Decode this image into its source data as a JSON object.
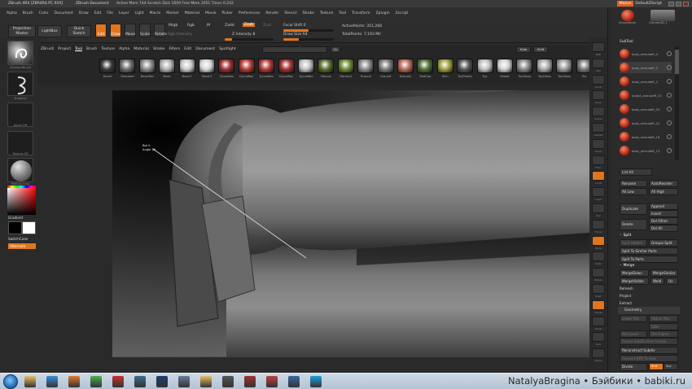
{
  "app": {
    "title": "ZBrush 4R4 [ZBR4R4.PC.XXX]",
    "document": "ZBrush Document",
    "stats": "Active Mem 744  Scratch Disk 1609  Free Mem 2051  Timer 0.242",
    "menus_button": "Menus",
    "script_label": "DefaultZScript"
  },
  "menubar": [
    "Alpha",
    "Brush",
    "Color",
    "Document",
    "Draw",
    "Edit",
    "File",
    "Layer",
    "Light",
    "Macro",
    "Marker",
    "Material",
    "Movie",
    "Picker",
    "Preferences",
    "Render",
    "Stencil",
    "Stroke",
    "Texture",
    "Tool",
    "Transform",
    "Zplugin",
    "Zscript"
  ],
  "topshelf": {
    "projection_master": "Projection Master",
    "lightbox": "LightBox",
    "quick_sketch": "Quick Sketch",
    "edit": "Edit",
    "draw": "Draw",
    "move": "Move",
    "scale": "Scale",
    "rotate": "Rotate",
    "mrgb": "Mrgb",
    "rgb": "Rgb",
    "m": "M",
    "zadd": "Zadd",
    "zsub": "Zsub",
    "zcut": "Zcut",
    "rgb_intensity": "Rgb Intensity",
    "z_intensity": "Z Intensity 8",
    "focal_shift": "Focal Shift 0",
    "draw_size": "Draw Size 64",
    "active_points": "ActivePoints: 351,268",
    "total_points": "TotalPoints: 7.193 Mil",
    "focal_shift_level": 0.5,
    "draw_size_level": 0.3,
    "z_intensity_level": 0.15
  },
  "toolpalette": {
    "tabs": [
      "ZBrush",
      "Project",
      "Tool",
      "Brush",
      "Texture",
      "Alpha",
      "Material",
      "Stroke",
      "Filters",
      "Edit",
      "Document",
      "Spotlight"
    ],
    "active_tab": "Tool",
    "go_button": "Go",
    "hide_button": "Hide",
    "shift_button": "Shift",
    "items": [
      {
        "label": "DamS",
        "color": "#3a3a3a"
      },
      {
        "label": "Standard",
        "color": "#6a6a6a"
      },
      {
        "label": "BasicMat",
        "color": "#8a8a8a"
      },
      {
        "label": "Basic",
        "color": "#b0b0b0"
      },
      {
        "label": "Basic2",
        "color": "#c8c8c8"
      },
      {
        "label": "Basic3",
        "color": "#d4d4d4"
      },
      {
        "label": "DynaWax",
        "color": "#9a3030"
      },
      {
        "label": "DynaWax",
        "color": "#b83a3a"
      },
      {
        "label": "DynaWax",
        "color": "#b03a3a"
      },
      {
        "label": "DynaWax",
        "color": "#a33030"
      },
      {
        "label": "DynaWax",
        "color": "#c0c0c0"
      },
      {
        "label": "Fibrous",
        "color": "#596c2f"
      },
      {
        "label": "Fibrous1",
        "color": "#6a8a33"
      },
      {
        "label": "Ground",
        "color": "#8a8a8a"
      },
      {
        "label": "Ground",
        "color": "#7a7a7a"
      },
      {
        "label": "Kutsuko",
        "color": "#b86a5a"
      },
      {
        "label": "MatCap",
        "color": "#50703a"
      },
      {
        "label": "Skin",
        "color": "#a0a040"
      },
      {
        "label": "ToyPlastic",
        "color": "#555"
      },
      {
        "label": "Toy",
        "color": "#c0c0c0"
      },
      {
        "label": "Shade",
        "color": "#d0d0d0"
      },
      {
        "label": "ToyGlass",
        "color": "#888"
      },
      {
        "label": "ToyGlass",
        "color": "#aaa"
      },
      {
        "label": "ToyGlass",
        "color": "#999"
      },
      {
        "label": "Toy",
        "color": "#777"
      }
    ]
  },
  "leftshelf": {
    "brush": "StandardBrush",
    "stroke": "DragDot",
    "alpha": "Alpha Off",
    "texture": "Texture Off",
    "material": "MatCap Gray",
    "gradient": "Gradient",
    "switch_color": "SwitchColor",
    "alternate": "Alternate"
  },
  "viewport": {
    "label_a": "Rot 0",
    "label_b": "Angle 35"
  },
  "rightshelf": [
    "BPR",
    "SPix",
    "Scroll",
    "Zoom",
    "Actual",
    "AAHalf",
    "Persp",
    "Floor",
    "Local",
    "L.Sym",
    "Xyz",
    "Frame",
    "Move",
    "Scale",
    "Rotate",
    "PolyF",
    "Transp",
    "Ghost",
    "Solo",
    "Xpose"
  ],
  "tray": {
    "lightbox_tool": "SimpleBrush",
    "cylinder": "Cylinder3D_1",
    "subtool_title": "SubTool",
    "subtools": [
      "body_extrudeR_4",
      "body_extrudeR_3",
      "body_extrudeR_2",
      "bodyA_extrudeR_21",
      "body_extrudeR_20",
      "body_extrudeR_21",
      "body_extrudeR_18",
      "body_extrudeR_13"
    ],
    "list_all": "List All",
    "rename": "Rename",
    "auto_reorder": "AutoReorder",
    "all_low": "All Low",
    "all_high": "All High",
    "duplicate": "Duplicate",
    "append": "Append",
    "insert": "Insert",
    "delete": "Delete",
    "del_other": "Del Other",
    "del_all": "Del All",
    "split": "Split",
    "split_hidden": "Split Hidden",
    "groups_split": "Groups Split",
    "split_similar": "Split To Similar Parts",
    "split_parts": "Split To Parts",
    "merge": "Merge",
    "merge_down": "MergeDown",
    "merge_similar": "MergeSimilar",
    "merge_visible": "MergeVisible",
    "weld": "Weld",
    "uv": "Uv",
    "remesh": "Remesh",
    "project": "Project",
    "extract": "Extract",
    "geometry": "Geometry",
    "lower_res": "Lower Res",
    "higher_res": "Higher Res",
    "sdiv": "SDiv",
    "del_lower": "Del Lower",
    "del_higher": "Del Higher",
    "freeze": "Freeze SubDivision Levels",
    "reconstruct": "Reconstruct Subdiv",
    "convert_bpr": "Convert BPR To Geo",
    "divide": "Divide",
    "smt": "Smt",
    "suv": "Suv",
    "rsmt": "ReUV"
  },
  "watermark": "NatalyaBragina • Бэйбики • babiki.ru"
}
